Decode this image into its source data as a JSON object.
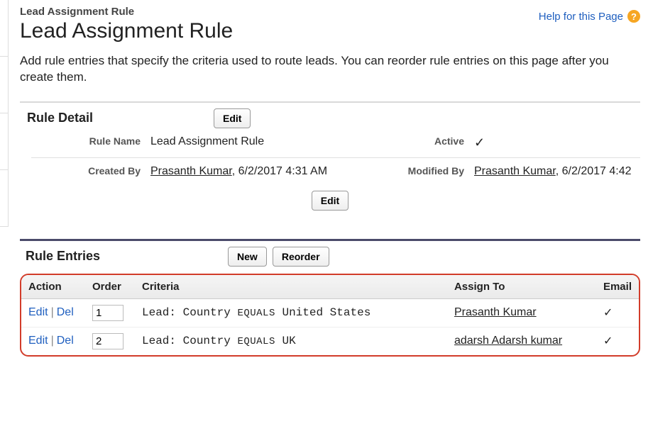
{
  "breadcrumb": "Lead Assignment Rule",
  "page_title": "Lead Assignment Rule",
  "help_label": "Help for this Page",
  "intro": "Add rule entries that specify the criteria used to route leads. You can reorder rule entries on this page after you create them.",
  "rule_detail": {
    "section_title": "Rule Detail",
    "edit_label": "Edit",
    "labels": {
      "rule_name": "Rule Name",
      "active": "Active",
      "created_by": "Created By",
      "modified_by": "Modified By"
    },
    "rule_name": "Lead Assignment Rule",
    "active": true,
    "created_by_user": "Prasanth Kumar",
    "created_by_time": ", 6/2/2017 4:31 AM",
    "modified_by_user": "Prasanth Kumar",
    "modified_by_time": ", 6/2/2017 4:42"
  },
  "rule_entries": {
    "section_title": "Rule Entries",
    "new_label": "New",
    "reorder_label": "Reorder",
    "columns": {
      "action": "Action",
      "order": "Order",
      "criteria": "Criteria",
      "assign_to": "Assign To",
      "email": "Email"
    },
    "action_edit": "Edit",
    "action_del": "Del",
    "rows": [
      {
        "order": "1",
        "criteria_prefix": "Lead: Country",
        "criteria_op": "EQUALS",
        "criteria_value": "United States",
        "assign_to": "Prasanth Kumar",
        "email": true
      },
      {
        "order": "2",
        "criteria_prefix": "Lead: Country",
        "criteria_op": "EQUALS",
        "criteria_value": "UK",
        "assign_to": "adarsh Adarsh kumar",
        "email": true
      }
    ]
  }
}
